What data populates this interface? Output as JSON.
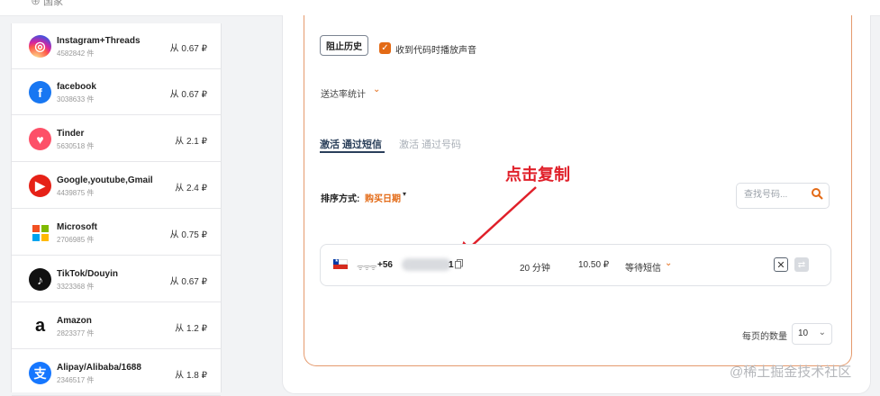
{
  "topbar": {
    "crumb": "⊕ 国家"
  },
  "services": [
    {
      "id": "instagram",
      "name": "Instagram+Threads",
      "count": "4582842 件",
      "price": "从 0.67 ₽",
      "color": "#d62976",
      "glyph": "◎"
    },
    {
      "id": "facebook",
      "name": "facebook",
      "count": "3038633 件",
      "price": "从 0.67 ₽",
      "color": "#1877f2",
      "glyph": "f"
    },
    {
      "id": "tinder",
      "name": "Tinder",
      "count": "5630518 件",
      "price": "从 2.1 ₽",
      "color": "#fd5068",
      "glyph": "♥"
    },
    {
      "id": "google",
      "name": "Google,youtube,Gmail",
      "count": "4439875 件",
      "price": "从 2.4 ₽",
      "color": "#e62117",
      "glyph": "▶"
    },
    {
      "id": "microsoft",
      "name": "Microsoft",
      "count": "2706985 件",
      "price": "从 0.75 ₽",
      "color": "#ffffff",
      "glyph": ""
    },
    {
      "id": "tiktok",
      "name": "TikTok/Douyin",
      "count": "3323368 件",
      "price": "从 0.67 ₽",
      "color": "#111111",
      "glyph": "♪"
    },
    {
      "id": "amazon",
      "name": "Amazon",
      "count": "2823377 件",
      "price": "从 1.2 ₽",
      "color": "#ffffff",
      "glyph": "a"
    },
    {
      "id": "alipay",
      "name": "Alipay/Alibaba/1688",
      "count": "2346517 件",
      "price": "从 1.8 ₽",
      "color": "#1677ff",
      "glyph": "支"
    }
  ],
  "controls": {
    "block_history": "阻止历史",
    "sound_label": "收到代码时播放声音",
    "sound_checked": true,
    "delivery_stats": "送达率统计"
  },
  "tabs": {
    "active": "激活 通过短信",
    "inactive": "激活 通过号码"
  },
  "annotation": "点击复制",
  "sort": {
    "label": "排序方式:",
    "value": "购买日期"
  },
  "search": {
    "placeholder": "查找号码..."
  },
  "order": {
    "country_flag": "chile-flag",
    "signal": "ᯤᯤᯤ",
    "phone_prefix": "+56",
    "phone_suffix": "1",
    "duration": "20 分钟",
    "price": "10.50 ₽",
    "status": "等待短信"
  },
  "pagination": {
    "label": "每页的数量",
    "value": "10"
  },
  "watermark": "@稀土掘金技术社区",
  "colors": {
    "accent": "#e36a16",
    "annotation": "#e0202a",
    "tab_active": "#2a3f5a"
  }
}
